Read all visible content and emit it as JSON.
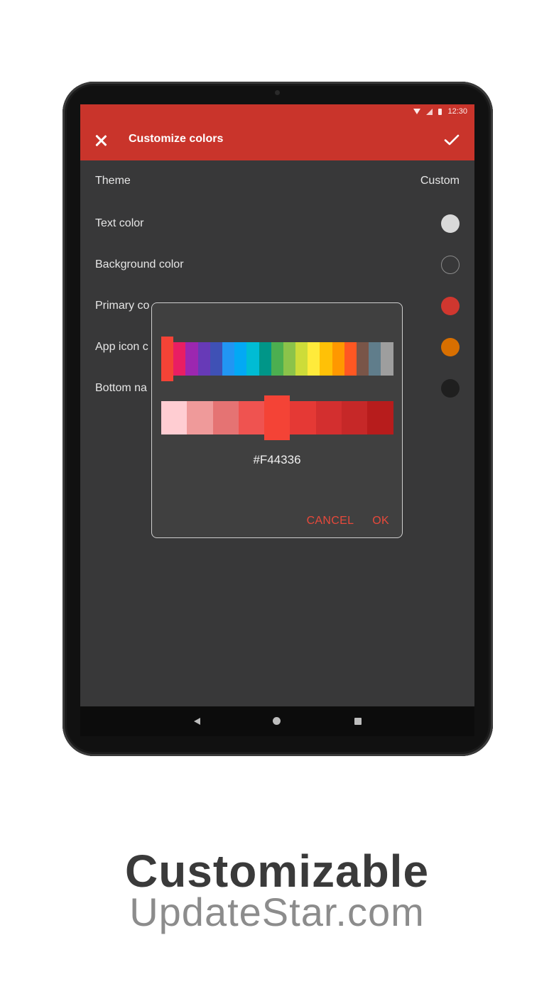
{
  "status": {
    "time": "12:30"
  },
  "appbar": {
    "title": "Customize colors",
    "close_icon": "close-icon",
    "confirm_icon": "check-icon",
    "color": "#c9342b"
  },
  "settings": [
    {
      "label": "Theme",
      "value": "Custom"
    },
    {
      "label": "Text color",
      "swatch": "#d9d9d9"
    },
    {
      "label": "Background color",
      "swatch": "#383839"
    },
    {
      "label": "Primary co",
      "swatch": "#d0372f"
    },
    {
      "label": "App icon c",
      "swatch": "#d86f00"
    },
    {
      "label": "Bottom na",
      "swatch": "#1f1f1f"
    }
  ],
  "dialog": {
    "palette": [
      "#f44336",
      "#e91e63",
      "#9c27b0",
      "#673ab7",
      "#3f51b5",
      "#2196f3",
      "#03a9f4",
      "#00bcd4",
      "#009688",
      "#4caf50",
      "#8bc34a",
      "#cddc39",
      "#ffeb3b",
      "#ffc107",
      "#ff9800",
      "#ff5722",
      "#795548",
      "#607d8b",
      "#9e9e9e"
    ],
    "selected_palette_index": 0,
    "shades": [
      "#ffcdd2",
      "#ef9a9a",
      "#e57373",
      "#ef5350",
      "#f44336",
      "#e53935",
      "#d32f2f",
      "#c62828",
      "#b71c1c"
    ],
    "selected_shade_index": 4,
    "hex": "#F44336",
    "cancel_label": "CANCEL",
    "ok_label": "OK"
  },
  "nav": {
    "back_icon": "back-triangle-icon",
    "home_icon": "home-circle-icon",
    "recents_icon": "recents-square-icon"
  },
  "caption": {
    "title": "Customizable",
    "watermark": "UpdateStar.com"
  }
}
